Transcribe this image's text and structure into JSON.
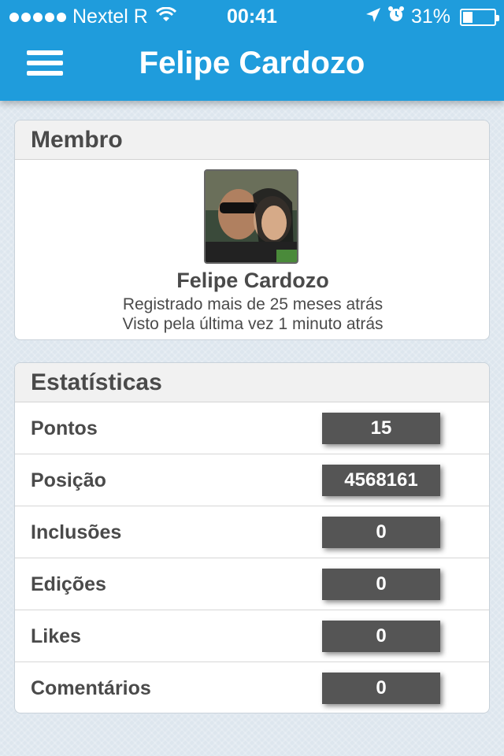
{
  "status_bar": {
    "carrier": "Nextel R",
    "time": "00:41",
    "battery": "31%",
    "battery_level": 0.31
  },
  "header": {
    "title": "Felipe Cardozo",
    "menu_icon": "hamburger-icon"
  },
  "member": {
    "section_title": "Membro",
    "name": "Felipe Cardozo",
    "registered": "Registrado mais de 25 meses atrás",
    "last_seen": "Visto pela última vez 1 minuto atrás"
  },
  "stats": {
    "section_title": "Estatísticas",
    "rows": [
      {
        "label": "Pontos",
        "value": "15"
      },
      {
        "label": "Posição",
        "value": "4568161"
      },
      {
        "label": "Inclusões",
        "value": "0"
      },
      {
        "label": "Edições",
        "value": "0"
      },
      {
        "label": "Likes",
        "value": "0"
      },
      {
        "label": "Comentários",
        "value": "0"
      }
    ]
  },
  "colors": {
    "header_bg": "#1f9cdc",
    "value_badge_bg": "#555555"
  }
}
